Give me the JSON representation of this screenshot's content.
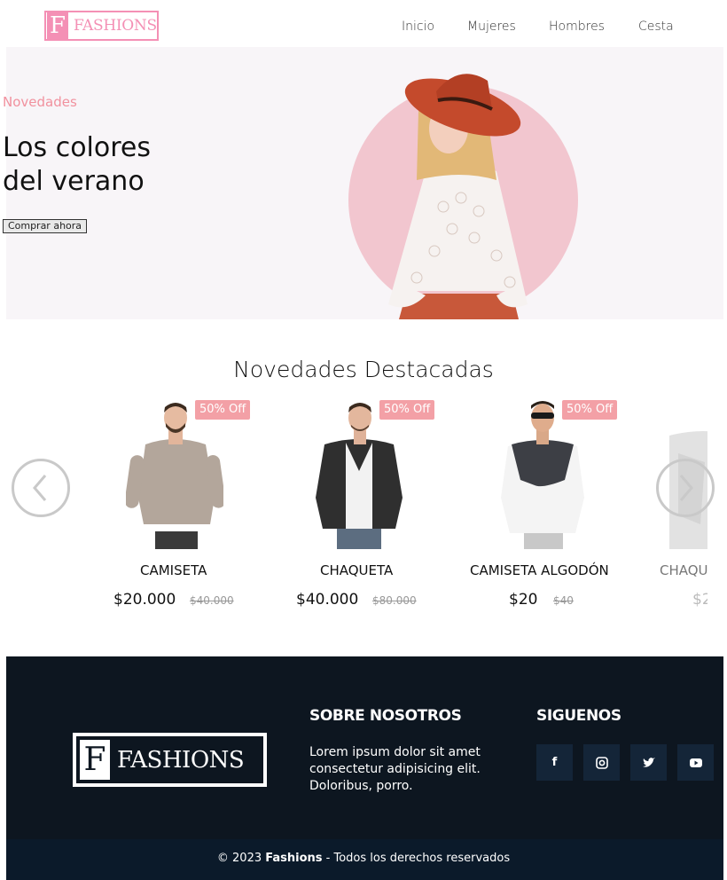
{
  "brand": {
    "letter": "F",
    "name": "FASHIONS",
    "color": "#f490b5"
  },
  "nav": [
    "Inicio",
    "Mujeres",
    "Hombres",
    "Cesta"
  ],
  "hero": {
    "kicker": "Novedades",
    "title_line1": "Los colores",
    "title_line2": "del verano",
    "button": "Comprar ahora"
  },
  "featured": {
    "title": "Novedades Destacadas",
    "prev_icon": "chevron-left-icon",
    "next_icon": "chevron-right-icon",
    "products": [
      {
        "badge": "50% Off",
        "name": "CAMISETA",
        "price": "$20.000",
        "old_price": "$40.000"
      },
      {
        "badge": "50% Off",
        "name": "CHAQUETA",
        "price": "$40.000",
        "old_price": "$80.000"
      },
      {
        "badge": "50% Off",
        "name": "CAMISETA ALGODÓN",
        "price": "$20",
        "old_price": "$40"
      },
      {
        "name": "CHAQU",
        "price": "$2"
      }
    ]
  },
  "footer": {
    "about_title": "SOBRE NOSOTROS",
    "about_text": "Lorem ipsum dolor sit amet consectetur adipisicing elit. Doloribus, porro.",
    "follow_title": "SIGUENOS",
    "social": [
      {
        "icon": "facebook-icon",
        "glyph": "f"
      },
      {
        "icon": "instagram-icon",
        "glyph": "◎"
      },
      {
        "icon": "twitter-icon",
        "glyph": "t"
      },
      {
        "icon": "youtube-icon",
        "glyph": "▶"
      }
    ],
    "copyright_prefix": "© 2023 ",
    "copyright_brand": "Fashions",
    "copyright_suffix": " - Todos los derechos reservados"
  },
  "colors": {
    "accent": "#f490b5",
    "badge": "#f3a0a6",
    "footer": "#0d1620",
    "hero_circle": "#f2c6cf"
  }
}
